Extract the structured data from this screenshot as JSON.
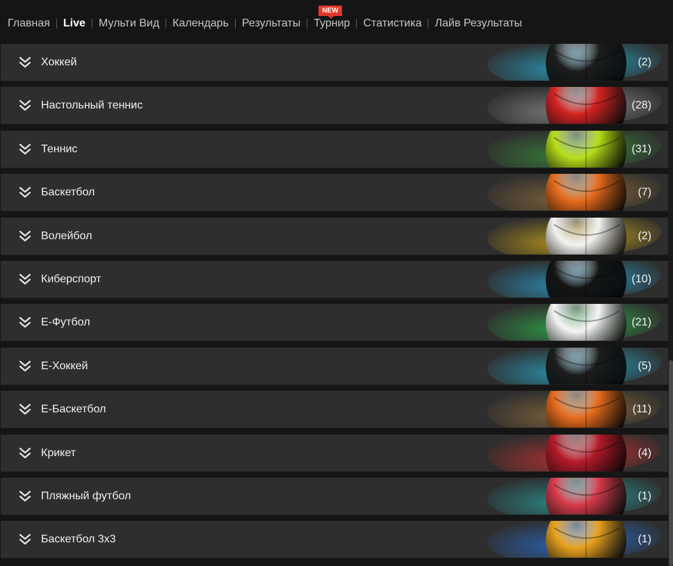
{
  "nav": {
    "items": [
      {
        "label": "Главная",
        "active": false
      },
      {
        "label": "Live",
        "active": true
      },
      {
        "label": "Мульти Вид",
        "active": false
      },
      {
        "label": "Календарь",
        "active": false
      },
      {
        "label": "Результаты",
        "active": false
      },
      {
        "label": "Турнир",
        "active": false
      },
      {
        "label": "Статистика",
        "active": false
      },
      {
        "label": "Лайв Результаты",
        "active": false
      }
    ],
    "new_badge": "NEW"
  },
  "sports": [
    {
      "label": "Хоккей",
      "count": "(2)",
      "icon": "hockey-puck-icon",
      "ball": "#1d1d1d",
      "smoke": "#2aa6c8"
    },
    {
      "label": "Настольный теннис",
      "count": "(28)",
      "icon": "table-tennis-icon",
      "ball": "#d42222",
      "smoke": "#8a8a8a"
    },
    {
      "label": "Теннис",
      "count": "(31)",
      "icon": "tennis-ball-icon",
      "ball": "#b6dd18",
      "smoke": "#3a8a3a"
    },
    {
      "label": "Баскетбол",
      "count": "(7)",
      "icon": "basketball-icon",
      "ball": "#e56a1c",
      "smoke": "#8a6a3a"
    },
    {
      "label": "Волейбол",
      "count": "(2)",
      "icon": "volleyball-icon",
      "ball": "#f2f2f2",
      "smoke": "#c8a318"
    },
    {
      "label": "Киберспорт",
      "count": "(10)",
      "icon": "gaming-mouse-icon",
      "ball": "#141414",
      "smoke": "#2a9ac8"
    },
    {
      "label": "Е-Футбол",
      "count": "(21)",
      "icon": "soccer-ball-icon",
      "ball": "#f4f4f4",
      "smoke": "#2fae4a"
    },
    {
      "label": "Е-Хоккей",
      "count": "(5)",
      "icon": "hockey-puck-icon",
      "ball": "#1d1d1d",
      "smoke": "#2aa6c8"
    },
    {
      "label": "Е-Баскетбол",
      "count": "(11)",
      "icon": "basketball-icon",
      "ball": "#e56a1c",
      "smoke": "#8a6a3a"
    },
    {
      "label": "Крикет",
      "count": "(4)",
      "icon": "cricket-ball-icon",
      "ball": "#b51b2a",
      "smoke": "#c23030"
    },
    {
      "label": "Пляжный футбол",
      "count": "(1)",
      "icon": "beach-soccer-ball-icon",
      "ball": "#d83a4a",
      "smoke": "#2a9a9a"
    },
    {
      "label": "Баскетбол 3x3",
      "count": "(1)",
      "icon": "basketball-icon",
      "ball": "#e8a11c",
      "smoke": "#2a6ac8"
    }
  ]
}
